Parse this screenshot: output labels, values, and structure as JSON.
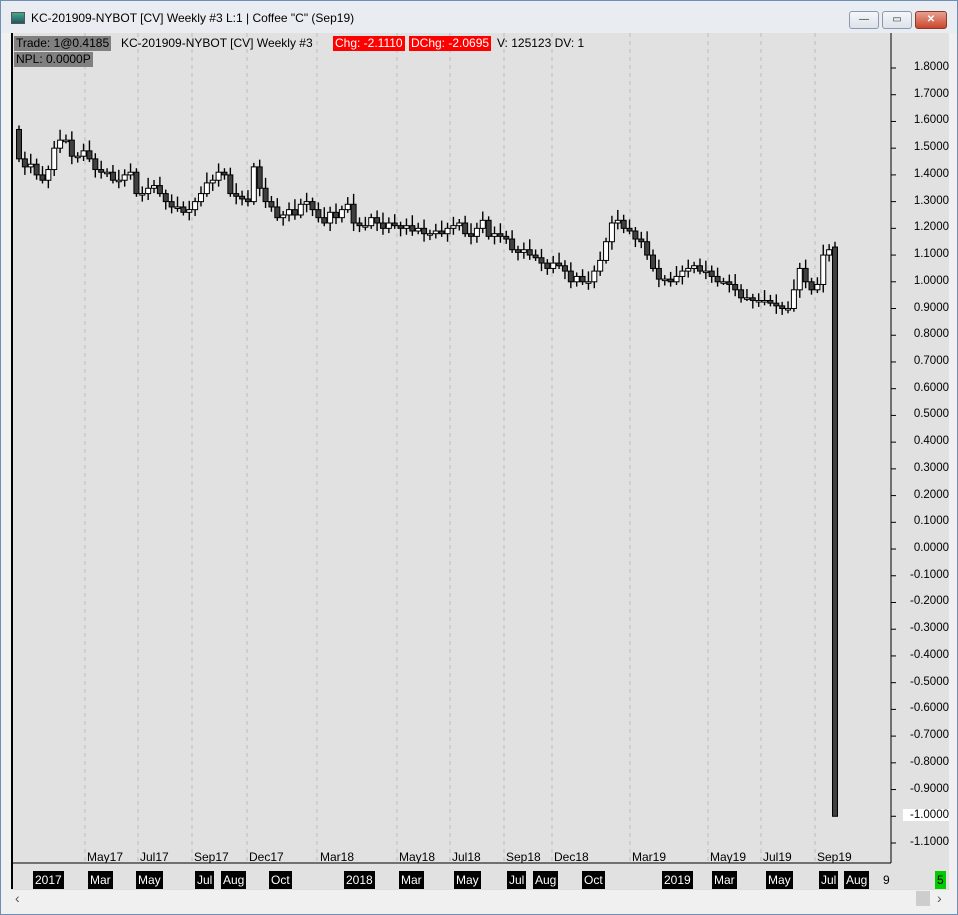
{
  "window": {
    "title": "KC-201909-NYBOT [CV]  Weekly  #3  L:1 | Coffee \"C\" (Sep19)",
    "minimize": "—",
    "maximize": "▭",
    "close": "✕"
  },
  "header": {
    "trade": "Trade: 1@0.4185",
    "symbol": "KC-201909-NYBOT [CV]   Weekly   #3",
    "chg": "Chg: -2.1110",
    "dchg": "DChg: -2.0695",
    "volume": "V: 125123  DV: 1",
    "npl": "NPL: 0.0000P"
  },
  "colors": {
    "bg": "#e1e1e1",
    "bear": "#404040",
    "bull": "#ffffff",
    "red": "#ff0000",
    "green": "#00cc00"
  },
  "chart_data": {
    "type": "candlestick",
    "ylim": [
      -1.1,
      1.8
    ],
    "yticks": [
      "1.8000",
      "1.7000",
      "1.6000",
      "1.5000",
      "1.4000",
      "1.3000",
      "1.2000",
      "1.1000",
      "1.0000",
      "0.9000",
      "0.8000",
      "0.7000",
      "0.6000",
      "0.5000",
      "0.4000",
      "0.3000",
      "0.2000",
      "0.1000",
      "0.0000",
      "-0.1000",
      "-0.2000",
      "-0.3000",
      "-0.4000",
      "-0.5000",
      "-0.6000",
      "-0.7000",
      "-0.8000",
      "-0.9000",
      "-1.0000",
      "-1.1000"
    ],
    "first_open": 1.57,
    "closes": [
      1.46,
      1.43,
      1.44,
      1.4,
      1.38,
      1.42,
      1.5,
      1.53,
      1.53,
      1.47,
      1.47,
      1.49,
      1.46,
      1.42,
      1.41,
      1.41,
      1.38,
      1.38,
      1.4,
      1.41,
      1.33,
      1.33,
      1.35,
      1.36,
      1.33,
      1.3,
      1.28,
      1.28,
      1.26,
      1.27,
      1.3,
      1.33,
      1.37,
      1.38,
      1.41,
      1.4,
      1.33,
      1.32,
      1.31,
      1.3,
      1.43,
      1.35,
      1.3,
      1.28,
      1.24,
      1.25,
      1.27,
      1.25,
      1.29,
      1.3,
      1.27,
      1.24,
      1.22,
      1.26,
      1.24,
      1.27,
      1.29,
      1.22,
      1.21,
      1.21,
      1.24,
      1.22,
      1.2,
      1.22,
      1.21,
      1.2,
      1.21,
      1.19,
      1.2,
      1.18,
      1.18,
      1.19,
      1.18,
      1.2,
      1.21,
      1.22,
      1.18,
      1.17,
      1.2,
      1.23,
      1.17,
      1.18,
      1.17,
      1.16,
      1.12,
      1.11,
      1.12,
      1.1,
      1.09,
      1.07,
      1.05,
      1.07,
      1.06,
      1.04,
      1.0,
      1.02,
      1.0,
      1.0,
      1.04,
      1.08,
      1.15,
      1.22,
      1.23,
      1.2,
      1.19,
      1.16,
      1.15,
      1.1,
      1.05,
      1.01,
      1.01,
      1.0,
      1.02,
      1.04,
      1.05,
      1.06,
      1.04,
      1.04,
      1.02,
      1.0,
      1.0,
      0.99,
      0.97,
      0.94,
      0.94,
      0.93,
      0.93,
      0.93,
      0.92,
      0.91,
      0.9,
      0.9,
      0.97,
      1.05,
      1.0,
      0.97,
      0.99,
      1.1,
      1.12
    ],
    "last_candle": {
      "open": 1.13,
      "high": 1.15,
      "low": -1.0,
      "close": -1.0
    },
    "month_labels": [
      "May17",
      "Jul17",
      "Sep17",
      "Dec17",
      "Mar18",
      "May18",
      "Jul18",
      "Sep18",
      "Dec18",
      "Mar19",
      "May19",
      "Jul19",
      "Sep19"
    ],
    "bottom_labels": [
      "2017",
      "Mar",
      "May",
      "Jul",
      "Aug",
      "Oct",
      "2018",
      "Mar",
      "May",
      "Jul",
      "Aug",
      "Oct",
      "2019",
      "Mar",
      "May",
      "Jul",
      "Aug"
    ],
    "bottom_extra": "9",
    "bottom_badge": "5"
  },
  "scrollbar": {
    "left": "‹",
    "right": "›"
  }
}
